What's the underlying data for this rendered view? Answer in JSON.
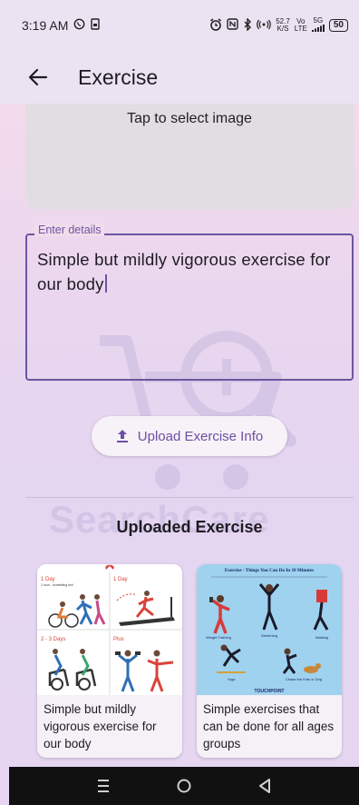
{
  "status_bar": {
    "time": "3:19 AM",
    "net_speed_top": "52.7",
    "net_speed_bottom": "K/S",
    "volte_top": "Vo",
    "volte_bottom": "LTE",
    "network": "5G",
    "battery": "50"
  },
  "app_bar": {
    "title": "Exercise",
    "back_icon": "arrow-back-icon"
  },
  "image_picker": {
    "label": "Tap to select image"
  },
  "details": {
    "label": "Enter details",
    "value": "Simple but mildly vigorous exercise for our body"
  },
  "upload_button": {
    "label": "Upload Exercise Info",
    "icon": "upload-icon"
  },
  "watermark": {
    "text": "SearchCare"
  },
  "uploaded_section": {
    "title": "Uploaded Exercise",
    "items": [
      {
        "caption": "Simple but mildly vigorous exercise for our body",
        "image_texts": [
          "1 Day",
          "1 hour - something fun!",
          "1 Day",
          "2 - 3 Days",
          "Plus"
        ]
      },
      {
        "caption": "Simple exercises that can be done for all ages groups",
        "image_texts": [
          "Exercise - Things You Can Do In 10 Minutes",
          "Weight Training",
          "Stretching",
          "Walking",
          "Yoga",
          "Chase the Kids or Dog",
          "TOUCHPOINT"
        ]
      }
    ]
  },
  "nav_bar": {
    "recent_icon": "menu-lines-icon",
    "home_icon": "circle-home-icon",
    "back_icon": "triangle-back-icon"
  },
  "colors": {
    "accent": "#6b56a0",
    "button_text": "#6d4fa3",
    "app_bar_bg": "#ebe3f2",
    "picker_bg": "#e2dde3"
  }
}
